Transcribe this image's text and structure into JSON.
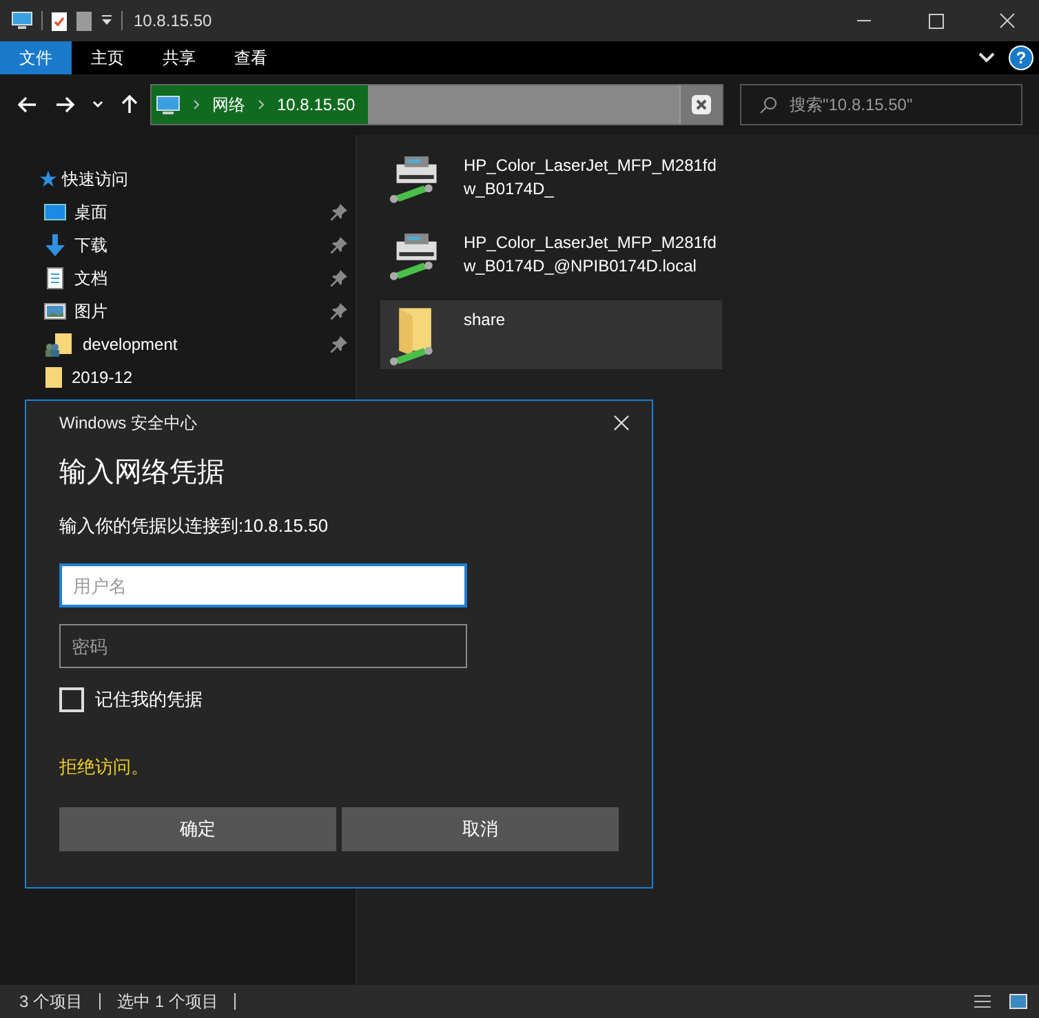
{
  "window": {
    "title": "10.8.15.50"
  },
  "ribbon_tabs": [
    {
      "label": "文件",
      "selected": true
    },
    {
      "label": "主页",
      "selected": false
    },
    {
      "label": "共享",
      "selected": false
    },
    {
      "label": "查看",
      "selected": false
    }
  ],
  "help_button": "?",
  "address_bar": {
    "path": [
      "网络",
      "10.8.15.50"
    ],
    "level": 0.38
  },
  "search": {
    "placeholder": "搜索\"10.8.15.50\""
  },
  "sidebar": {
    "items": [
      {
        "label": "快速访问",
        "kind": "star",
        "children": [
          {
            "label": "桌面",
            "kind": "desktop",
            "pinned": true
          },
          {
            "label": "下载",
            "kind": "download",
            "pinned": true
          },
          {
            "label": "文档",
            "kind": "document",
            "pinned": true
          },
          {
            "label": "图片",
            "kind": "picture",
            "pinned": true
          },
          {
            "label": "development",
            "kind": "shared-folder",
            "pinned": true
          },
          {
            "label": "2019-12",
            "kind": "folder",
            "pinned": false
          }
        ]
      }
    ]
  },
  "files": [
    {
      "name": "HP_Color_LaserJet_MFP_M281fdw_B0174D_",
      "kind": "printer",
      "selected": false
    },
    {
      "name": "HP_Color_LaserJet_MFP_M281fdw_B0174D_@NPIB0174D.local",
      "kind": "printer",
      "selected": false
    },
    {
      "name": "share",
      "kind": "share",
      "selected": true
    }
  ],
  "status_bar": {
    "item_count": "3 个项目",
    "selection": "选中 1 个项目"
  },
  "dialog": {
    "caption": "Windows 安全中心",
    "title": "输入网络凭据",
    "message": "输入你的凭据以连接到:10.8.15.50",
    "username": {
      "placeholder": "用户名",
      "focused": true
    },
    "password": {
      "placeholder": "密码",
      "focused": false
    },
    "remember": {
      "label": "记住我的凭据",
      "checked": false
    },
    "error": "拒绝访问。",
    "buttons": [
      "确定",
      "取消"
    ]
  }
}
